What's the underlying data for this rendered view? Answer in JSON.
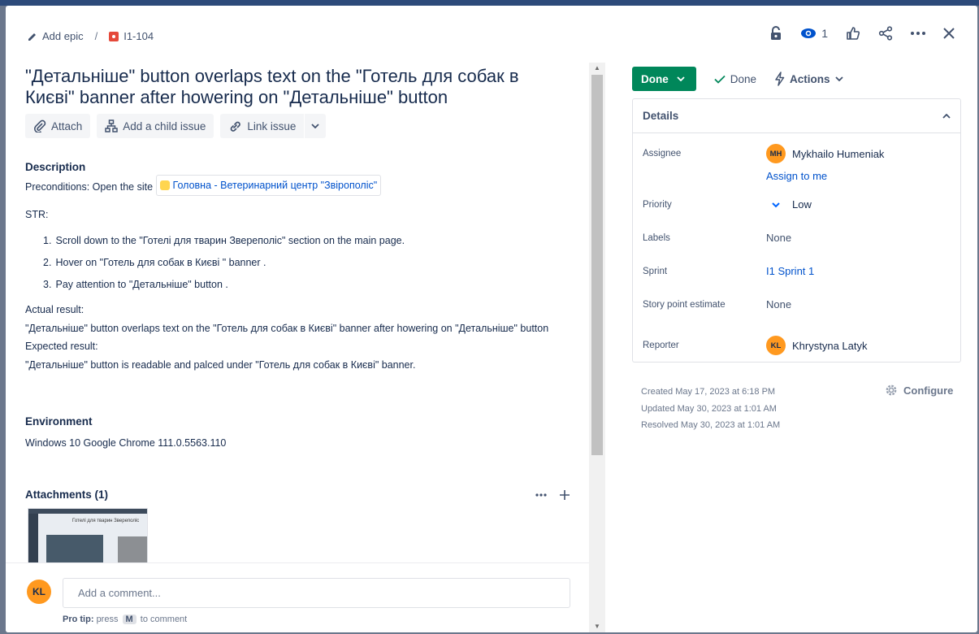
{
  "breadcrumb": {
    "add_epic": "Add epic",
    "separator": "/",
    "issue_key": "I1-104"
  },
  "header_actions": {
    "watchers_count": "1"
  },
  "issue": {
    "title": "\"Детальніше\" button overlaps text on the \"Готель для собак в Києві\" banner after howering on \"Детальніше\" button"
  },
  "toolbar": {
    "attach": "Attach",
    "add_child": "Add a child issue",
    "link_issue": "Link issue"
  },
  "description": {
    "heading": "Description",
    "preconditions_prefix": "Preconditions: Open the site",
    "smartlink_text": "Головна - Ветеринарний центр \"Звірополіс\"",
    "str_label": "STR:",
    "steps": [
      {
        "num": "1.",
        "text": "Scroll down to the \"Готелі для тварин Звереполіс\" section on the main page."
      },
      {
        "num": "2.",
        "text": "Hover on \"Готель для собак в Києві \" banner ."
      },
      {
        "num": "3.",
        "text": "Pay attention to  \"Детальніше\" button ."
      }
    ],
    "actual_label": "Actual result:",
    "actual_text": "\"Детальніше\" button overlaps text on the \"Готель для собак в Києві\" banner after howering on \"Детальніше\" button",
    "expected_label": "Expected result:",
    "expected_text": "\"Детальніше\" button  is readable and palced under \"Готель для собак в Києві\" banner."
  },
  "environment": {
    "heading": "Environment",
    "value": "Windows 10 Google Chrome 111.0.5563.110"
  },
  "attachments": {
    "heading": "Attachments (1)",
    "thumb_heading": "Готелі для тварин Звереполіс"
  },
  "comment": {
    "avatar_initials": "KL",
    "placeholder": "Add a comment...",
    "pro_tip_label": "Pro tip:",
    "pro_tip_press": "press",
    "pro_tip_key": "M",
    "pro_tip_suffix": "to comment"
  },
  "status": {
    "button": "Done",
    "resolution": "Done",
    "actions": "Actions"
  },
  "details": {
    "heading": "Details",
    "assignee_label": "Assignee",
    "assignee_initials": "MH",
    "assignee_name": "Mykhailo Humeniak",
    "assign_to_me": "Assign to me",
    "priority_label": "Priority",
    "priority_value": "Low",
    "labels_label": "Labels",
    "labels_value": "None",
    "sprint_label": "Sprint",
    "sprint_value": "I1 Sprint 1",
    "story_points_label": "Story point estimate",
    "story_points_value": "None",
    "reporter_label": "Reporter",
    "reporter_initials": "KL",
    "reporter_name": "Khrystyna Latyk"
  },
  "meta": {
    "created": "Created May 17, 2023 at 6:18 PM",
    "updated": "Updated May 30, 2023 at 1:01 AM",
    "resolved": "Resolved May 30, 2023 at 1:01 AM",
    "configure": "Configure"
  },
  "colors": {
    "done_green": "#00875a",
    "link_blue": "#0052cc",
    "avatar_orange": "#ff991f",
    "bug_red": "#e5493a"
  }
}
